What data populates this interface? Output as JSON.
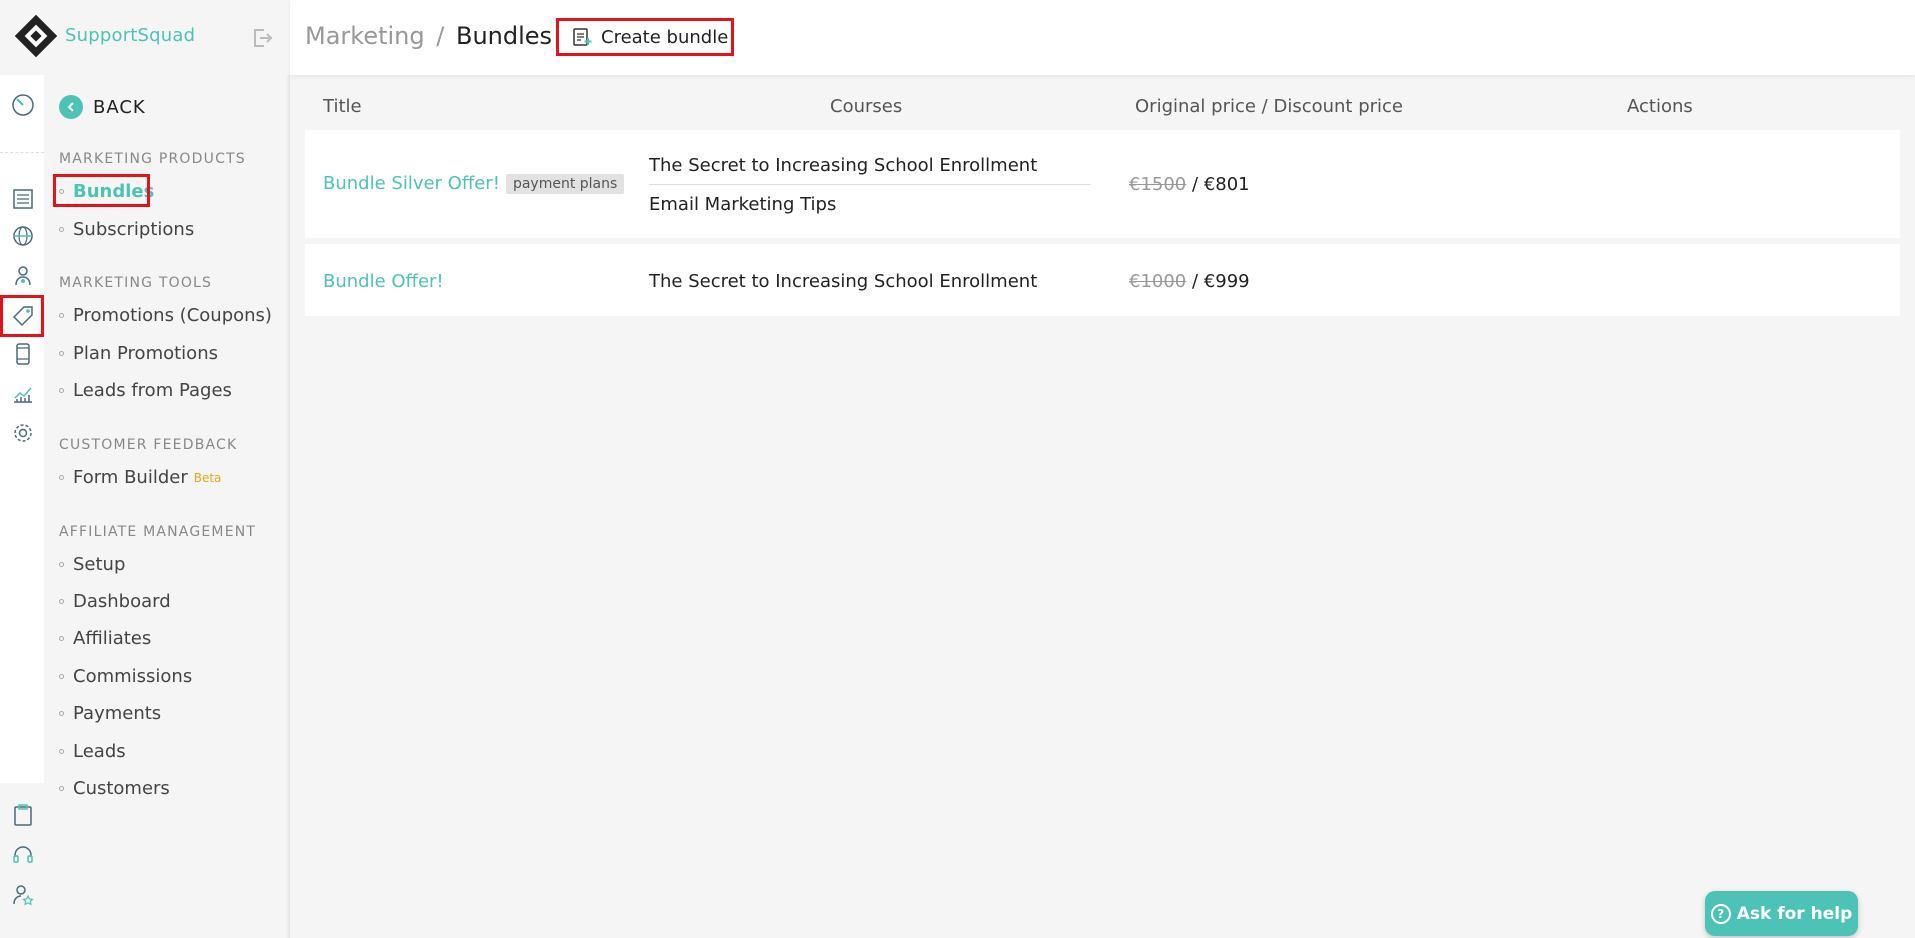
{
  "brand": {
    "name": "SupportSquad"
  },
  "colors": {
    "accent": "#4dc3b8",
    "highlight": "#e3131b",
    "beta": "#e6a817"
  },
  "rail": {
    "icons": [
      "dashboard-icon",
      "list-icon",
      "globe-icon",
      "user-icon",
      "tag-icon",
      "mobile-icon",
      "chart-icon",
      "gear-icon",
      "clipboard-icon",
      "headset-icon",
      "star-user-icon"
    ]
  },
  "submenu": {
    "back_label": "BACK",
    "sections": {
      "products": {
        "title": "MARKETING PRODUCTS",
        "items": [
          "Bundles",
          "Subscriptions"
        ]
      },
      "tools": {
        "title": "MARKETING TOOLS",
        "items": [
          "Promotions (Coupons)",
          "Plan Promotions",
          "Leads from Pages"
        ]
      },
      "feedback": {
        "title": "CUSTOMER FEEDBACK",
        "items": [
          "Form Builder"
        ],
        "beta_label": "Beta"
      },
      "affiliate": {
        "title": "AFFILIATE MANAGEMENT",
        "items": [
          "Setup",
          "Dashboard",
          "Affiliates",
          "Commissions",
          "Payments",
          "Leads",
          "Customers"
        ]
      }
    }
  },
  "header": {
    "breadcrumb_parent": "Marketing",
    "breadcrumb_sep": "/",
    "breadcrumb_current": "Bundles",
    "create_label": "Create bundle"
  },
  "table": {
    "headers": [
      "Title",
      "Courses",
      "Original price / Discount price",
      "Actions"
    ],
    "rows": [
      {
        "title": "Bundle Silver Offer!",
        "badge": "payment plans",
        "courses": [
          "The Secret to Increasing School Enrollment",
          "Email Marketing Tips"
        ],
        "original": "€1500",
        "sep": "/",
        "discount": "€801"
      },
      {
        "title": "Bundle Offer!",
        "courses": [
          "The Secret to Increasing School Enrollment"
        ],
        "original": "€1000",
        "sep": "/",
        "discount": "€999"
      }
    ]
  },
  "help": {
    "label": "Ask for help",
    "q": "?"
  }
}
